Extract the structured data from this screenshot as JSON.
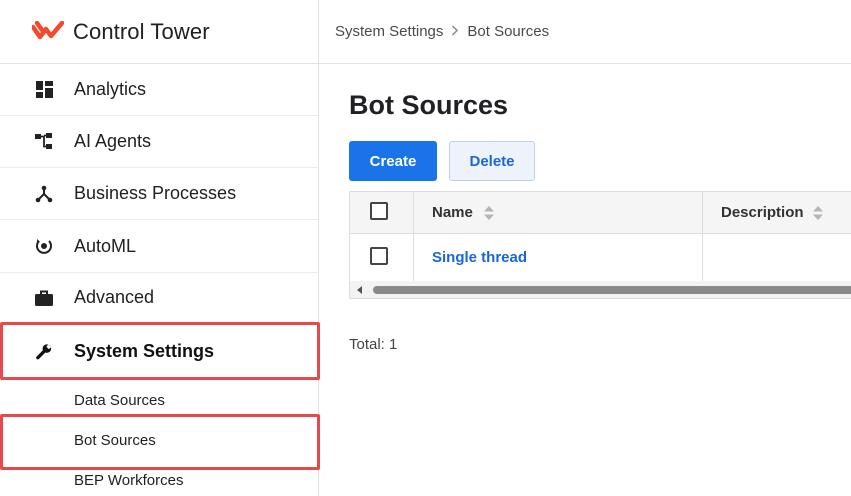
{
  "app": {
    "title": "Control Tower",
    "logo_icon": "control-tower-logo-icon",
    "brand_color": "#f24a2a"
  },
  "sidebar": {
    "items": [
      {
        "label": "Analytics",
        "icon": "dashboard-icon"
      },
      {
        "label": "AI Agents",
        "icon": "hierarchy-icon"
      },
      {
        "label": "Business Processes",
        "icon": "branch-icon"
      },
      {
        "label": "AutoML",
        "icon": "automl-icon"
      },
      {
        "label": "Advanced",
        "icon": "briefcase-icon"
      },
      {
        "label": "System Settings",
        "icon": "wrench-icon",
        "selected": true
      }
    ],
    "sub_items": [
      {
        "label": "Data Sources"
      },
      {
        "label": "Bot Sources",
        "selected": true
      },
      {
        "label": "BEP Workforces"
      }
    ]
  },
  "breadcrumb": {
    "items": [
      "System Settings",
      "Bot Sources"
    ],
    "separator_icon": "chevron-right-icon"
  },
  "main": {
    "title": "Bot Sources",
    "create_label": "Create",
    "delete_label": "Delete",
    "table": {
      "columns": [
        "Name",
        "Description"
      ],
      "rows": [
        {
          "name": "Single thread",
          "description": ""
        }
      ]
    },
    "total": "Total: 1"
  },
  "colors": {
    "primary": "#1a73e8",
    "link": "#1a66d9",
    "highlight": "#e5484d"
  }
}
